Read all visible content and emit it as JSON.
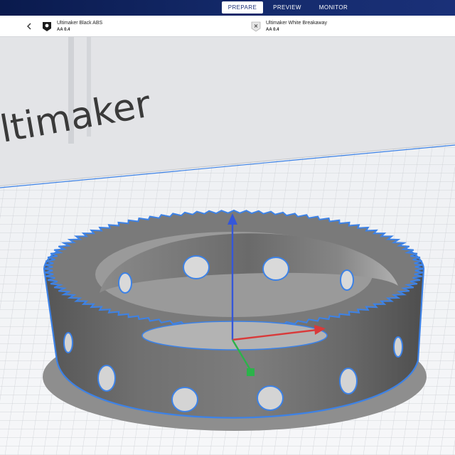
{
  "header": {
    "tabs": [
      {
        "label": "PREPARE",
        "active": true
      },
      {
        "label": "PREVIEW",
        "active": false
      },
      {
        "label": "MONITOR",
        "active": false
      }
    ]
  },
  "extruders": [
    {
      "material": "Ultimaker Black ABS",
      "core": "AA 0.4",
      "icon": "filament-spool-icon"
    },
    {
      "material": "Ultimaker White Breakaway",
      "core": "AA 0.4",
      "icon": "filament-spool-icon"
    }
  ],
  "viewport": {
    "printer_brand_text": "ltimaker",
    "colors": {
      "accent": "#1a3078",
      "model": "#6b6b6b",
      "outline": "#3d82e6",
      "axis_x": "#d93a3a",
      "axis_y": "#2bb34a",
      "axis_z": "#3557d9"
    }
  }
}
